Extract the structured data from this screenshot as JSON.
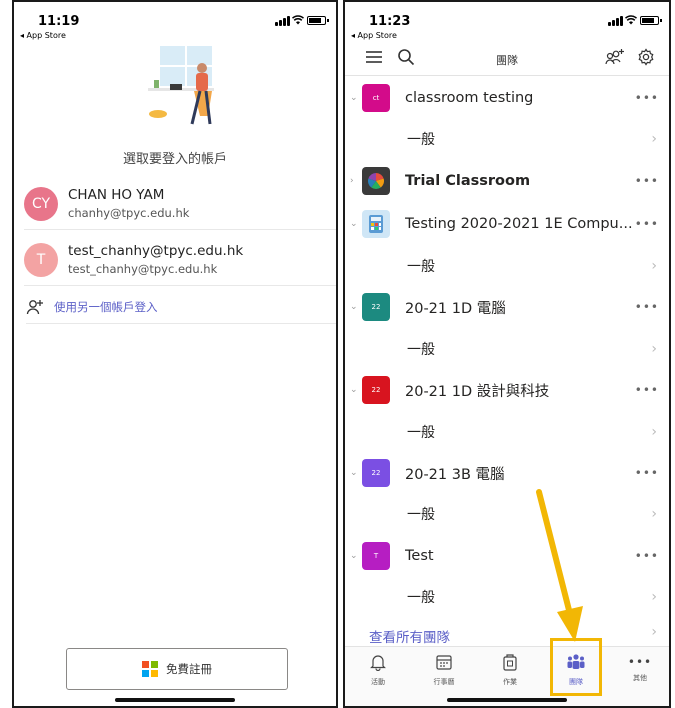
{
  "left": {
    "status": {
      "time": "11:19",
      "back": "◂ App Store"
    },
    "choose_title": "選取要登入的帳戶",
    "accounts": [
      {
        "initials": "CY",
        "name": "CHAN HO YAM",
        "email": "chanhy@tpyc.edu.hk",
        "color": "#e8758a"
      },
      {
        "initials": "T",
        "name": "test_chanhy@tpyc.edu.hk",
        "email": "test_chanhy@tpyc.edu.hk",
        "color": "#f3a3a3"
      }
    ],
    "other_account": "使用另一個帳戶登入",
    "signup": "免費註冊"
  },
  "right": {
    "status": {
      "time": "11:23",
      "back": "◂ App Store"
    },
    "title": "團隊",
    "teams": [
      {
        "avatar": "ct",
        "name": "classroom testing",
        "color": "#d30b8a",
        "channel": "一般"
      },
      {
        "avatar": "",
        "name": "Trial Classroom",
        "color": "#3a3a3a",
        "channel": ""
      },
      {
        "avatar": "",
        "name": "Testing 2020-2021 1E Compu...",
        "color": "#cfe6f6",
        "channel": "一般"
      },
      {
        "avatar": "22",
        "name": "20-21 1D 電腦",
        "color": "#1c8a80",
        "channel": "一般"
      },
      {
        "avatar": "22",
        "name": "20-21 1D 設計與科技",
        "color": "#d8141f",
        "channel": "一般"
      },
      {
        "avatar": "22",
        "name": "20-21 3B 電腦",
        "color": "#7b4fe3",
        "channel": "一般"
      },
      {
        "avatar": "T",
        "name": "Test",
        "color": "#b61ec2",
        "channel": "一般"
      }
    ],
    "see_all": "查看所有團隊",
    "nav": [
      {
        "label": "活動",
        "icon": "bell-icon"
      },
      {
        "label": "行事曆",
        "icon": "calendar-icon"
      },
      {
        "label": "作業",
        "icon": "assignments-icon"
      },
      {
        "label": "團隊",
        "icon": "teams-icon"
      },
      {
        "label": "其他",
        "icon": "more-icon"
      }
    ],
    "accent": "#5b5fc7",
    "highlight_color": "#f2b705"
  }
}
